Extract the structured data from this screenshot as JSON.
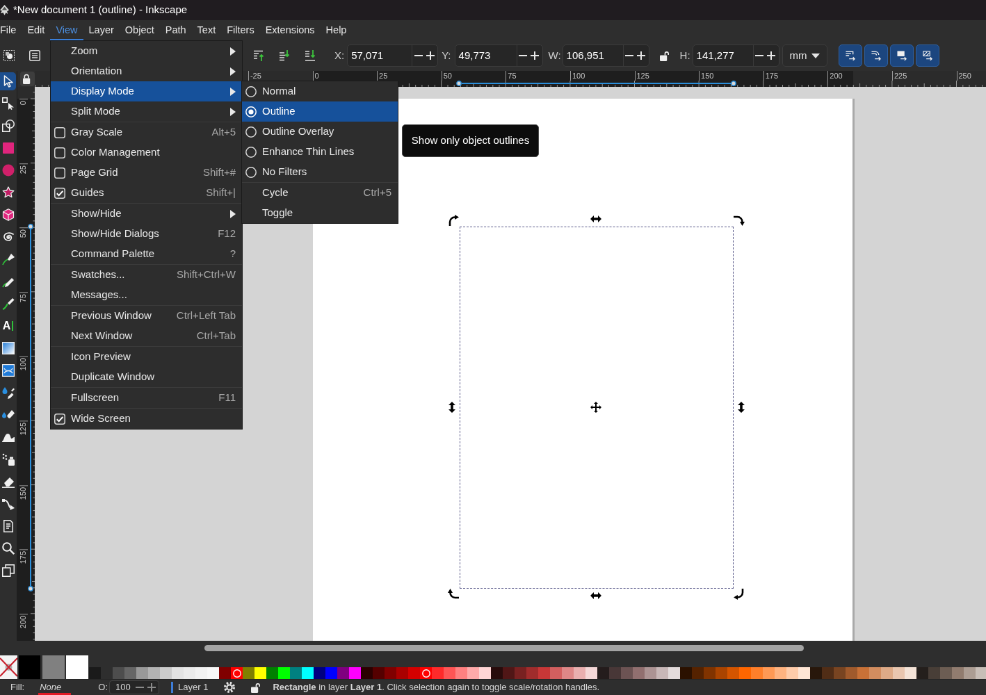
{
  "window": {
    "title": "*New document 1 (outline) - Inkscape"
  },
  "menubar": [
    {
      "label": "File",
      "selected": false
    },
    {
      "label": "Edit",
      "selected": false
    },
    {
      "label": "View",
      "selected": true
    },
    {
      "label": "Layer",
      "selected": false
    },
    {
      "label": "Object",
      "selected": false
    },
    {
      "label": "Path",
      "selected": false
    },
    {
      "label": "Text",
      "selected": false
    },
    {
      "label": "Filters",
      "selected": false
    },
    {
      "label": "Extensions",
      "selected": false
    },
    {
      "label": "Help",
      "selected": false
    }
  ],
  "toolbar": {
    "fields": [
      {
        "label": "X:",
        "value": "57,071"
      },
      {
        "label": "Y:",
        "value": "49,773"
      },
      {
        "label": "W:",
        "value": "106,951"
      },
      {
        "label": "H:",
        "value": "141,277"
      }
    ],
    "ratio_locked": false,
    "unit": "mm",
    "toggles": [
      {
        "kind": "stroke",
        "on": true
      },
      {
        "kind": "corners",
        "on": true
      },
      {
        "kind": "gradients",
        "on": true
      },
      {
        "kind": "patterns",
        "on": true
      }
    ]
  },
  "tools": [
    {
      "kind": "selector",
      "selected": true
    },
    {
      "kind": "node",
      "selected": false
    },
    {
      "kind": "builder",
      "selected": false
    },
    {
      "kind": "rect",
      "selected": false
    },
    {
      "kind": "ellipse",
      "selected": false
    },
    {
      "kind": "star",
      "selected": false
    },
    {
      "kind": "box3d",
      "selected": false
    },
    {
      "kind": "spiral",
      "selected": false
    },
    {
      "kind": "pen",
      "selected": false
    },
    {
      "kind": "pencil",
      "selected": false
    },
    {
      "kind": "calligraphy",
      "selected": false
    },
    {
      "kind": "text",
      "glyph": "A",
      "selected": false
    },
    {
      "kind": "gradient",
      "selected": false
    },
    {
      "kind": "mesh",
      "selected": false
    },
    {
      "kind": "dropper",
      "selected": false
    },
    {
      "kind": "bucket",
      "selected": false
    },
    {
      "kind": "tweak",
      "selected": false
    },
    {
      "kind": "spray",
      "selected": false
    },
    {
      "kind": "eraser",
      "selected": false
    },
    {
      "kind": "connector",
      "selected": false
    },
    {
      "kind": "document",
      "selected": false
    },
    {
      "kind": "zoom",
      "selected": false
    },
    {
      "kind": "pages",
      "selected": false
    }
  ],
  "rulers": {
    "horizontal": [
      "-25",
      "0",
      "25",
      "50",
      "75",
      "100",
      "125",
      "150",
      "175",
      "200",
      "225",
      "250"
    ],
    "vertical": [
      "0",
      "25",
      "50",
      "75",
      "100",
      "125",
      "150",
      "175",
      "200"
    ]
  },
  "view_menu": {
    "groups": [
      [
        {
          "label": "Zoom",
          "kind": "submenu",
          "highlighted": false
        },
        {
          "label": "Orientation",
          "kind": "submenu",
          "highlighted": false
        },
        {
          "label": "Display Mode",
          "kind": "submenu",
          "highlighted": true
        },
        {
          "label": "Split Mode",
          "kind": "submenu",
          "highlighted": false
        }
      ],
      [
        {
          "label": "Gray Scale",
          "kind": "check",
          "checked": false,
          "shortcut": "Alt+5",
          "highlighted": false
        },
        {
          "label": "Color Management",
          "kind": "check",
          "checked": false,
          "highlighted": false
        },
        {
          "label": "Page Grid",
          "kind": "check",
          "checked": false,
          "shortcut": "Shift+#",
          "highlighted": false
        },
        {
          "label": "Guides",
          "kind": "check",
          "checked": true,
          "shortcut": "Shift+|",
          "highlighted": false
        }
      ],
      [
        {
          "label": "Show/Hide",
          "kind": "submenu",
          "highlighted": false
        },
        {
          "label": "Show/Hide Dialogs",
          "kind": "item",
          "shortcut": "F12",
          "highlighted": false
        },
        {
          "label": "Command Palette",
          "kind": "item",
          "shortcut": "?",
          "highlighted": false
        }
      ],
      [
        {
          "label": "Swatches...",
          "kind": "item",
          "shortcut": "Shift+Ctrl+W",
          "highlighted": false
        },
        {
          "label": "Messages...",
          "kind": "item",
          "highlighted": false
        }
      ],
      [
        {
          "label": "Previous Window",
          "kind": "item",
          "shortcut": "Ctrl+Left Tab",
          "highlighted": false
        },
        {
          "label": "Next Window",
          "kind": "item",
          "shortcut": "Ctrl+Tab",
          "highlighted": false
        }
      ],
      [
        {
          "label": "Icon Preview",
          "kind": "item",
          "highlighted": false
        },
        {
          "label": "Duplicate Window",
          "kind": "item",
          "highlighted": false
        }
      ],
      [
        {
          "label": "Fullscreen",
          "kind": "item",
          "shortcut": "F11",
          "highlighted": false
        }
      ],
      [
        {
          "label": "Wide Screen",
          "kind": "check",
          "checked": true,
          "highlighted": false
        }
      ]
    ]
  },
  "display_mode_menu": {
    "groups": [
      [
        {
          "label": "Normal",
          "kind": "radio",
          "selected": false,
          "highlighted": false
        },
        {
          "label": "Outline",
          "kind": "radio",
          "selected": true,
          "highlighted": true
        },
        {
          "label": "Outline Overlay",
          "kind": "radio",
          "selected": false,
          "highlighted": false
        },
        {
          "label": "Enhance Thin Lines",
          "kind": "radio",
          "selected": false,
          "highlighted": false
        },
        {
          "label": "No Filters",
          "kind": "radio",
          "selected": false,
          "highlighted": false
        }
      ],
      [
        {
          "label": "Cycle",
          "kind": "item",
          "shortcut": "Ctrl+5",
          "highlighted": false
        },
        {
          "label": "Toggle",
          "kind": "item",
          "highlighted": false
        }
      ]
    ]
  },
  "tooltip": {
    "text": "Show only object outlines"
  },
  "palette": {
    "fixed": [
      {
        "kind": "none"
      },
      {
        "kind": "color",
        "color": "#000000"
      },
      {
        "kind": "color",
        "color": "#808080"
      },
      {
        "kind": "color",
        "color": "#ffffff"
      }
    ],
    "swatches": [
      {
        "color": "#1a1a1a",
        "marked": false
      },
      {
        "color": "#4d4d4d",
        "marked": false
      },
      {
        "color": "#666666",
        "marked": false
      },
      {
        "color": "#999999",
        "marked": false
      },
      {
        "color": "#b3b3b3",
        "marked": false
      },
      {
        "color": "#cccccc",
        "marked": false
      },
      {
        "color": "#e3e3e3",
        "marked": false
      },
      {
        "color": "#ebebeb",
        "marked": false
      },
      {
        "color": "#f2f2f2",
        "marked": false
      },
      {
        "color": "#f8f8f8",
        "marked": false
      },
      {
        "color": "#800000",
        "marked": false
      },
      {
        "color": "#ff0000",
        "marked": true
      },
      {
        "color": "#808000",
        "marked": false
      },
      {
        "color": "#ffff00",
        "marked": false
      },
      {
        "color": "#008000",
        "marked": false
      },
      {
        "color": "#00ff00",
        "marked": false
      },
      {
        "color": "#008080",
        "marked": false
      },
      {
        "color": "#00ffff",
        "marked": false
      },
      {
        "color": "#000080",
        "marked": false
      },
      {
        "color": "#0000ff",
        "marked": false
      },
      {
        "color": "#800080",
        "marked": false
      },
      {
        "color": "#ff00ff",
        "marked": false
      },
      {
        "color": "#2b0000",
        "marked": false
      },
      {
        "color": "#550000",
        "marked": false
      },
      {
        "color": "#800000",
        "marked": false
      },
      {
        "color": "#aa0000",
        "marked": false
      },
      {
        "color": "#d40000",
        "marked": false
      },
      {
        "color": "#ff0000",
        "marked": true
      },
      {
        "color": "#ff2a2a",
        "marked": false
      },
      {
        "color": "#ff5555",
        "marked": false
      },
      {
        "color": "#ff8080",
        "marked": false
      },
      {
        "color": "#ffaaaa",
        "marked": false
      },
      {
        "color": "#ffd5d5",
        "marked": false
      },
      {
        "color": "#280b0b",
        "marked": false
      },
      {
        "color": "#501616",
        "marked": false
      },
      {
        "color": "#782121",
        "marked": false
      },
      {
        "color": "#a02c2c",
        "marked": false
      },
      {
        "color": "#c83737",
        "marked": false
      },
      {
        "color": "#d35f5f",
        "marked": false
      },
      {
        "color": "#de8787",
        "marked": false
      },
      {
        "color": "#e9afaf",
        "marked": false
      },
      {
        "color": "#f4d7d7",
        "marked": false
      },
      {
        "color": "#241c1c",
        "marked": false
      },
      {
        "color": "#483737",
        "marked": false
      },
      {
        "color": "#6c5353",
        "marked": false
      },
      {
        "color": "#916f6f",
        "marked": false
      },
      {
        "color": "#ac9393",
        "marked": false
      },
      {
        "color": "#c8b7b7",
        "marked": false
      },
      {
        "color": "#e3dbdb",
        "marked": false
      },
      {
        "color": "#2b1100",
        "marked": false
      },
      {
        "color": "#552200",
        "marked": false
      },
      {
        "color": "#803300",
        "marked": false
      },
      {
        "color": "#aa4400",
        "marked": false
      },
      {
        "color": "#d45500",
        "marked": false
      },
      {
        "color": "#ff6600",
        "marked": false
      },
      {
        "color": "#ff7f2a",
        "marked": false
      },
      {
        "color": "#ff9955",
        "marked": false
      },
      {
        "color": "#ffb380",
        "marked": false
      },
      {
        "color": "#ffccaa",
        "marked": false
      },
      {
        "color": "#ffe6d5",
        "marked": false
      },
      {
        "color": "#28170b",
        "marked": false
      },
      {
        "color": "#502d16",
        "marked": false
      },
      {
        "color": "#784421",
        "marked": false
      },
      {
        "color": "#a05a2c",
        "marked": false
      },
      {
        "color": "#c87137",
        "marked": false
      },
      {
        "color": "#d38d5f",
        "marked": false
      },
      {
        "color": "#deaa87",
        "marked": false
      },
      {
        "color": "#e9c6af",
        "marked": false
      },
      {
        "color": "#f4e3d7",
        "marked": false
      },
      {
        "color": "#241f1c",
        "marked": false
      },
      {
        "color": "#483e37",
        "marked": false
      },
      {
        "color": "#6c5d53",
        "marked": false
      },
      {
        "color": "#917c6f",
        "marked": false
      },
      {
        "color": "#ac9d93",
        "marked": false
      },
      {
        "color": "#c8beb7",
        "marked": false
      }
    ]
  },
  "status_bar": {
    "fill_label": "Fill:",
    "fill_value": "None",
    "stroke": {
      "color": "#e01b24"
    },
    "opacity_label": "O:",
    "opacity_value": "100",
    "layer": "Layer 1",
    "message": "**Rectangle** in layer **Layer 1**. Click selection again to toggle scale/rotation handles."
  }
}
